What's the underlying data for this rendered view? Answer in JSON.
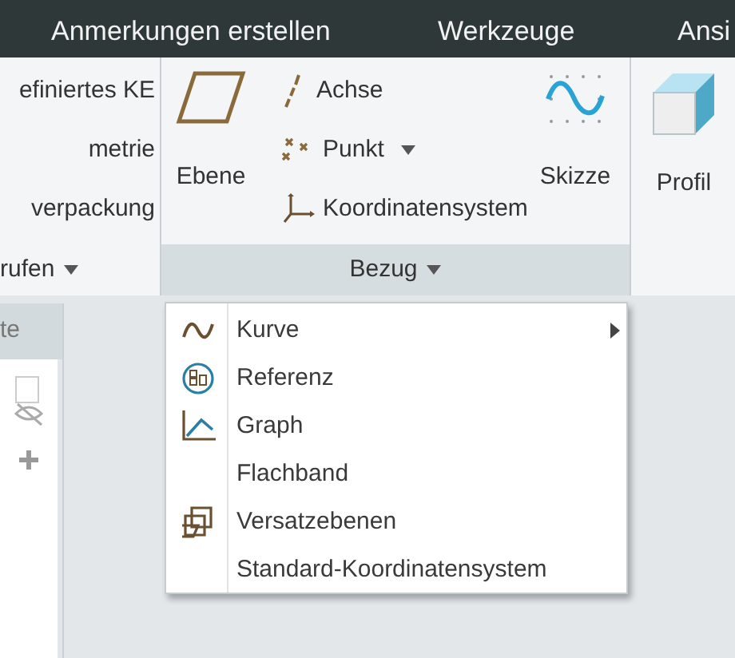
{
  "tabs": [
    {
      "label": "Anmerkungen erstellen"
    },
    {
      "label": "Werkzeuge"
    },
    {
      "label": "Ansi"
    }
  ],
  "left_group": {
    "items": [
      "efiniertes KE",
      "metrie",
      "verpackung"
    ],
    "footer": "rufen"
  },
  "bezug_group": {
    "plane": "Ebene",
    "items": [
      {
        "label": "Achse",
        "kind": "axis",
        "dropdown": false
      },
      {
        "label": "Punkt",
        "kind": "point",
        "dropdown": true
      },
      {
        "label": "Koordinatensystem",
        "kind": "csys",
        "dropdown": false
      }
    ],
    "sketch": "Skizze",
    "footer": "Bezug"
  },
  "profile": "Profil",
  "side_panel": {
    "header": "te"
  },
  "menu": [
    {
      "label": "Kurve",
      "kind": "curve",
      "submenu": true
    },
    {
      "label": "Referenz",
      "kind": "reference",
      "submenu": false
    },
    {
      "label": "Graph",
      "kind": "graph",
      "submenu": false
    },
    {
      "label": "Flachband",
      "kind": "plain",
      "submenu": false
    },
    {
      "label": "Versatzebenen",
      "kind": "offset",
      "submenu": false
    },
    {
      "label": "Standard-Koordinatensystem",
      "kind": "plain",
      "submenu": false
    }
  ]
}
